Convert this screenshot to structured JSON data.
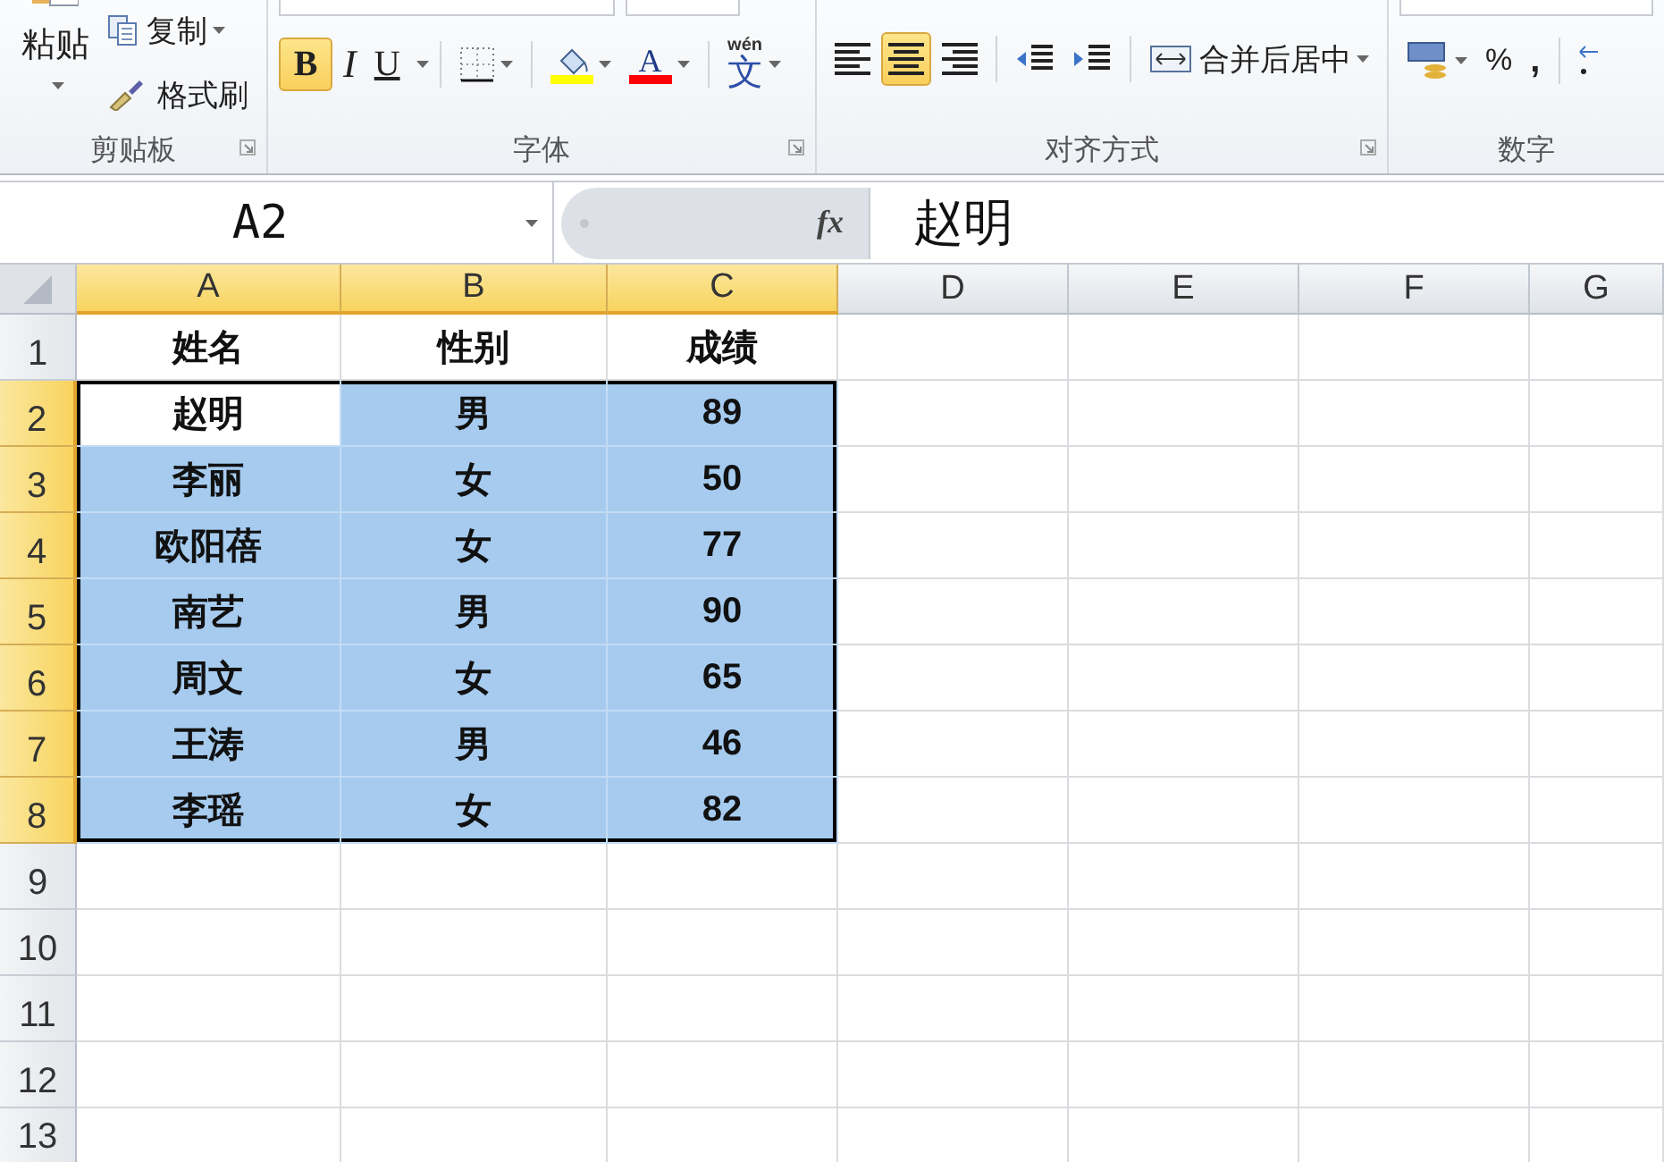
{
  "ribbon": {
    "groups": [
      {
        "kind": "clipboard",
        "label": "剪贴板",
        "paste": "粘贴",
        "copy": "复制",
        "painter": "格式刷",
        "launcher": true
      },
      {
        "kind": "font",
        "label": "字体",
        "bold": {
          "text": "B",
          "selected": true
        },
        "italic": {
          "text": "I",
          "selected": false
        },
        "underline": {
          "text": "U",
          "selected": false
        },
        "font_color": {
          "text": "A"
        },
        "phonetic": {
          "top": "wén",
          "main": "文"
        },
        "launcher": true
      },
      {
        "kind": "alignment",
        "label": "对齐方式",
        "aligns": [
          {
            "kind": "left",
            "selected": false
          },
          {
            "kind": "center",
            "selected": true
          },
          {
            "kind": "right",
            "selected": false
          }
        ],
        "merge": "合并后居中",
        "launcher": true
      },
      {
        "kind": "number",
        "label": "数字",
        "percent": "%",
        "comma": ","
      }
    ]
  },
  "formula_bar": {
    "name_box": "A2",
    "fx": "fx",
    "value": "赵明"
  },
  "sheet": {
    "columns": [
      {
        "label": "A",
        "selected": true
      },
      {
        "label": "B",
        "selected": true
      },
      {
        "label": "C",
        "selected": true
      },
      {
        "label": "D",
        "selected": false
      },
      {
        "label": "E",
        "selected": false
      },
      {
        "label": "F",
        "selected": false
      },
      {
        "label": "G",
        "selected": false
      }
    ],
    "rows": [
      {
        "header": "1",
        "selected": false,
        "cells": [
          {
            "text": "姓名",
            "selected": false,
            "active": false
          },
          {
            "text": "性别",
            "selected": false,
            "active": false
          },
          {
            "text": "成绩",
            "selected": false,
            "active": false
          }
        ]
      },
      {
        "header": "2",
        "selected": true,
        "cells": [
          {
            "text": "赵明",
            "selected": true,
            "active": true
          },
          {
            "text": "男",
            "selected": true,
            "active": false
          },
          {
            "text": "89",
            "selected": true,
            "active": false
          }
        ]
      },
      {
        "header": "3",
        "selected": true,
        "cells": [
          {
            "text": "李丽",
            "selected": true,
            "active": false
          },
          {
            "text": "女",
            "selected": true,
            "active": false
          },
          {
            "text": "50",
            "selected": true,
            "active": false
          }
        ]
      },
      {
        "header": "4",
        "selected": true,
        "cells": [
          {
            "text": "欧阳蓓",
            "selected": true,
            "active": false
          },
          {
            "text": "女",
            "selected": true,
            "active": false
          },
          {
            "text": "77",
            "selected": true,
            "active": false
          }
        ]
      },
      {
        "header": "5",
        "selected": true,
        "cells": [
          {
            "text": "南艺",
            "selected": true,
            "active": false
          },
          {
            "text": "男",
            "selected": true,
            "active": false
          },
          {
            "text": "90",
            "selected": true,
            "active": false
          }
        ]
      },
      {
        "header": "6",
        "selected": true,
        "cells": [
          {
            "text": "周文",
            "selected": true,
            "active": false
          },
          {
            "text": "女",
            "selected": true,
            "active": false
          },
          {
            "text": "65",
            "selected": true,
            "active": false
          }
        ]
      },
      {
        "header": "7",
        "selected": true,
        "cells": [
          {
            "text": "王涛",
            "selected": true,
            "active": false
          },
          {
            "text": "男",
            "selected": true,
            "active": false
          },
          {
            "text": "46",
            "selected": true,
            "active": false
          }
        ]
      },
      {
        "header": "8",
        "selected": true,
        "cells": [
          {
            "text": "李瑶",
            "selected": true,
            "active": false
          },
          {
            "text": "女",
            "selected": true,
            "active": false
          },
          {
            "text": "82",
            "selected": true,
            "active": false
          }
        ]
      },
      {
        "header": "9",
        "selected": false,
        "cells": []
      },
      {
        "header": "10",
        "selected": false,
        "cells": []
      },
      {
        "header": "11",
        "selected": false,
        "cells": []
      },
      {
        "header": "12",
        "selected": false,
        "cells": []
      },
      {
        "header": "13",
        "selected": false,
        "cells": []
      }
    ]
  }
}
